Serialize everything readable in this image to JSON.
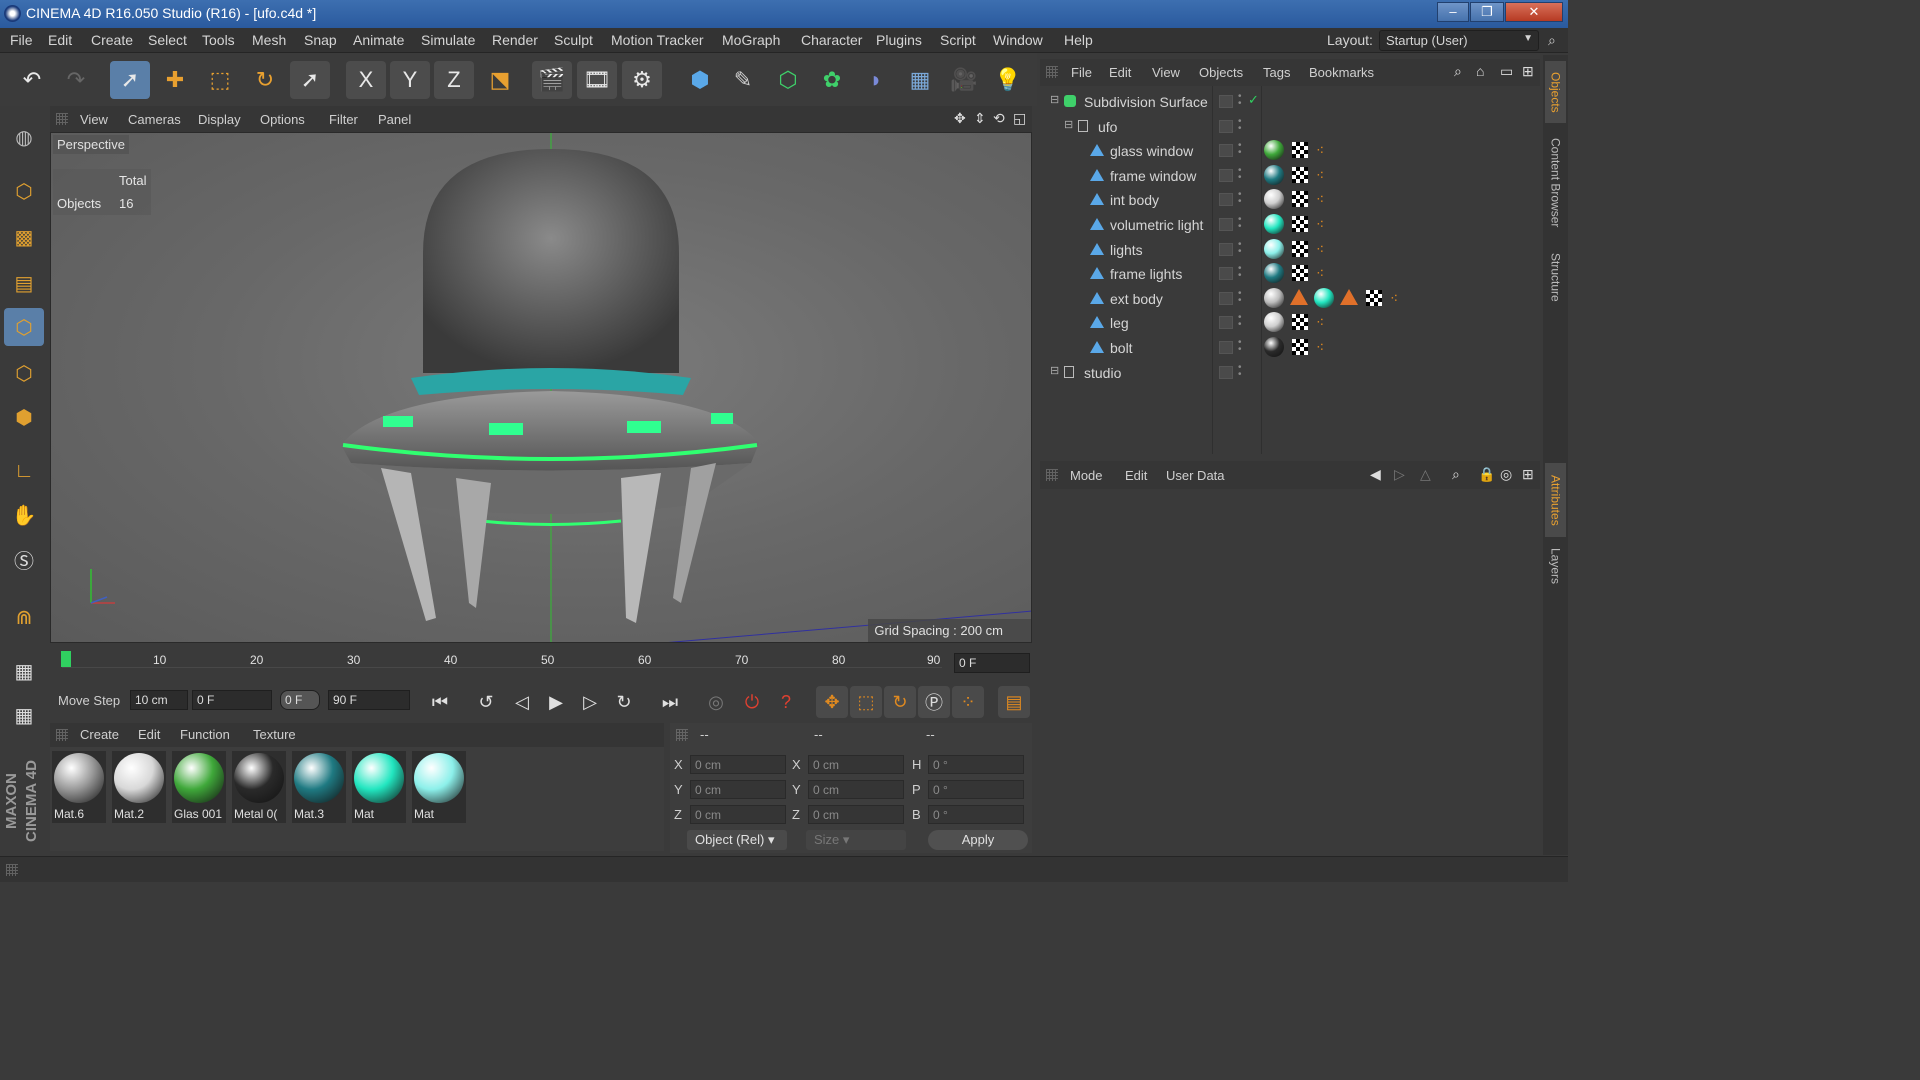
{
  "window": {
    "title": "CINEMA 4D R16.050 Studio (R16) - [ufo.c4d *]"
  },
  "menubar": {
    "items": [
      "File",
      "Edit",
      "Create",
      "Select",
      "Tools",
      "Mesh",
      "Snap",
      "Animate",
      "Simulate",
      "Render",
      "Sculpt",
      "Motion Tracker",
      "MoGraph",
      "Character",
      "Plugins",
      "Script",
      "Window",
      "Help"
    ],
    "layout_label": "Layout:",
    "layout_value": "Startup (User)"
  },
  "toolbar": {
    "icons": [
      "undo-icon",
      "redo-icon",
      "live-select-icon",
      "move-icon",
      "scale-icon",
      "rotate-icon",
      "select-icon",
      "x-axis-icon",
      "y-axis-icon",
      "z-axis-icon",
      "coordinate-system-icon",
      "render-view-icon",
      "render-picture-viewer-icon",
      "edit-render-settings-icon",
      "cube-icon",
      "spline-pen-icon",
      "subdivision-icon",
      "array-icon",
      "deformer-icon",
      "floor-icon",
      "camera-icon",
      "light-icon"
    ],
    "x_label": "X",
    "y_label": "Y",
    "z_label": "Z"
  },
  "viewport": {
    "menu": [
      "View",
      "Cameras",
      "Display",
      "Options",
      "Filter",
      "Panel"
    ],
    "camera_label": "Perspective",
    "stats_header": "Total",
    "stats_label": "Objects",
    "stats_value": "16",
    "grid_spacing": "Grid Spacing : 200 cm"
  },
  "timeline": {
    "ticks": [
      "0",
      "10",
      "20",
      "30",
      "40",
      "50",
      "60",
      "70",
      "80",
      "90"
    ],
    "current_frame": "0 F"
  },
  "transport": {
    "move_step_label": "Move Step",
    "move_step_value": "10 cm",
    "start_frame": "0 F",
    "preview_start": "0 F",
    "end_frame": "90 F"
  },
  "materials": {
    "menu": [
      "Create",
      "Edit",
      "Function",
      "Texture"
    ],
    "items": [
      {
        "name": "Mat.6",
        "color": "#9a9a9a"
      },
      {
        "name": "Mat.2",
        "color": "#d8d8d8"
      },
      {
        "name": "Glas 001",
        "color": "#3fa83a"
      },
      {
        "name": "Metal 0(",
        "color": "#2a2a2a"
      },
      {
        "name": "Mat.3",
        "color": "#1f7a82"
      },
      {
        "name": "Mat",
        "color": "#22e6c0"
      },
      {
        "name": "Mat",
        "color": "#8cf0ea"
      }
    ]
  },
  "coordinates": {
    "headers": [
      "--",
      "--",
      "--"
    ],
    "rows": [
      {
        "a_label": "X",
        "a_value": "0 cm",
        "b_label": "X",
        "b_value": "0 cm",
        "c_label": "H",
        "c_value": "0 °"
      },
      {
        "a_label": "Y",
        "a_value": "0 cm",
        "b_label": "Y",
        "b_value": "0 cm",
        "c_label": "P",
        "c_value": "0 °"
      },
      {
        "a_label": "Z",
        "a_value": "0 cm",
        "b_label": "Z",
        "b_value": "0 cm",
        "c_label": "B",
        "c_value": "0 °"
      }
    ],
    "mode": "Object (Rel)",
    "size": "Size",
    "apply": "Apply"
  },
  "object_manager": {
    "menu": [
      "File",
      "Edit",
      "View",
      "Objects",
      "Tags",
      "Bookmarks"
    ],
    "objects": [
      {
        "name": "Subdivision Surface",
        "level": 0,
        "type": "subdivision"
      },
      {
        "name": "ufo",
        "level": 1,
        "type": "null"
      },
      {
        "name": "glass window",
        "level": 2,
        "type": "poly",
        "mat": "#3fa83a"
      },
      {
        "name": "frame window",
        "level": 2,
        "type": "poly",
        "mat": "#1f7a82"
      },
      {
        "name": "int body",
        "level": 2,
        "type": "poly",
        "mat": "#cfcfcf"
      },
      {
        "name": "volumetric light",
        "level": 2,
        "type": "poly",
        "mat": "#22e6c0"
      },
      {
        "name": "lights",
        "level": 2,
        "type": "poly",
        "mat": "#8cf0ea"
      },
      {
        "name": "frame lights",
        "level": 2,
        "type": "poly",
        "mat": "#1f7a82"
      },
      {
        "name": "ext body",
        "level": 2,
        "type": "poly",
        "mat": "#bdbdbd"
      },
      {
        "name": "leg",
        "level": 2,
        "type": "poly",
        "mat": "#cfcfcf"
      },
      {
        "name": "bolt",
        "level": 2,
        "type": "poly",
        "mat": "#2a2a2a"
      },
      {
        "name": "studio",
        "level": 0,
        "type": "null"
      }
    ]
  },
  "attributes": {
    "menu": [
      "Mode",
      "Edit",
      "User Data"
    ]
  },
  "right_tabs": [
    "Objects",
    "Content Browser",
    "Structure",
    "Attributes",
    "Layers"
  ],
  "left_logo": "MAXON CINEMA 4D",
  "colors": {
    "accent": "#5a7fa8",
    "orange": "#e08a20",
    "teal": "#22e6c0"
  }
}
